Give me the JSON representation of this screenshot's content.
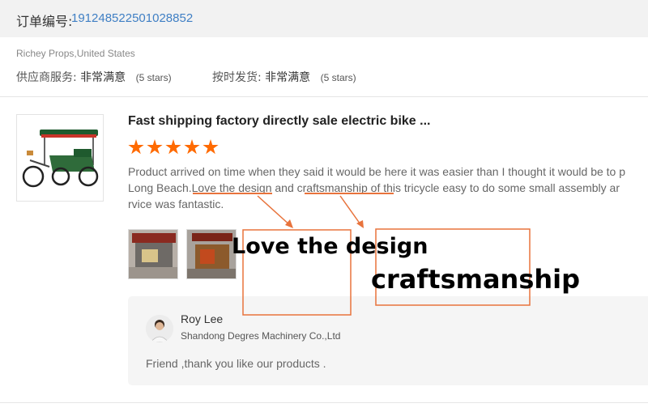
{
  "order": {
    "label": "订单编号:",
    "number": "191248522501028852"
  },
  "supplier": {
    "name": "Richey Props,United States",
    "ratings": [
      {
        "label": "供应商服务:",
        "value": "非常满意",
        "stars": "(5 stars)"
      },
      {
        "label": "按时发货:",
        "value": "非常满意",
        "stars": "(5 stars)"
      }
    ]
  },
  "product": {
    "title": "Fast shipping factory directly sale electric bike ...",
    "rating": 5,
    "review_lines": [
      [
        "Product arrived on time when they said it would be here it was easier than I thought it would be to p"
      ],
      [
        "Long Beach.",
        "Love the design",
        " and ",
        "craftsmanship",
        " of this tricycle easy to do some small assembly ar"
      ],
      [
        "rvice was fantastic."
      ]
    ]
  },
  "reply": {
    "name": "Roy Lee",
    "company": "Shandong Degres Machinery Co.,Ltd",
    "text": "Friend ,thank you like our products ."
  },
  "annotations": {
    "label1": "Love the design",
    "label2": "craftsmanship",
    "color": "#e8733c"
  },
  "colors": {
    "accent": "#ff6a00",
    "link": "#3f7fc4"
  },
  "icons": [
    "star-icon",
    "tricycle-image",
    "review-photo",
    "avatar"
  ]
}
